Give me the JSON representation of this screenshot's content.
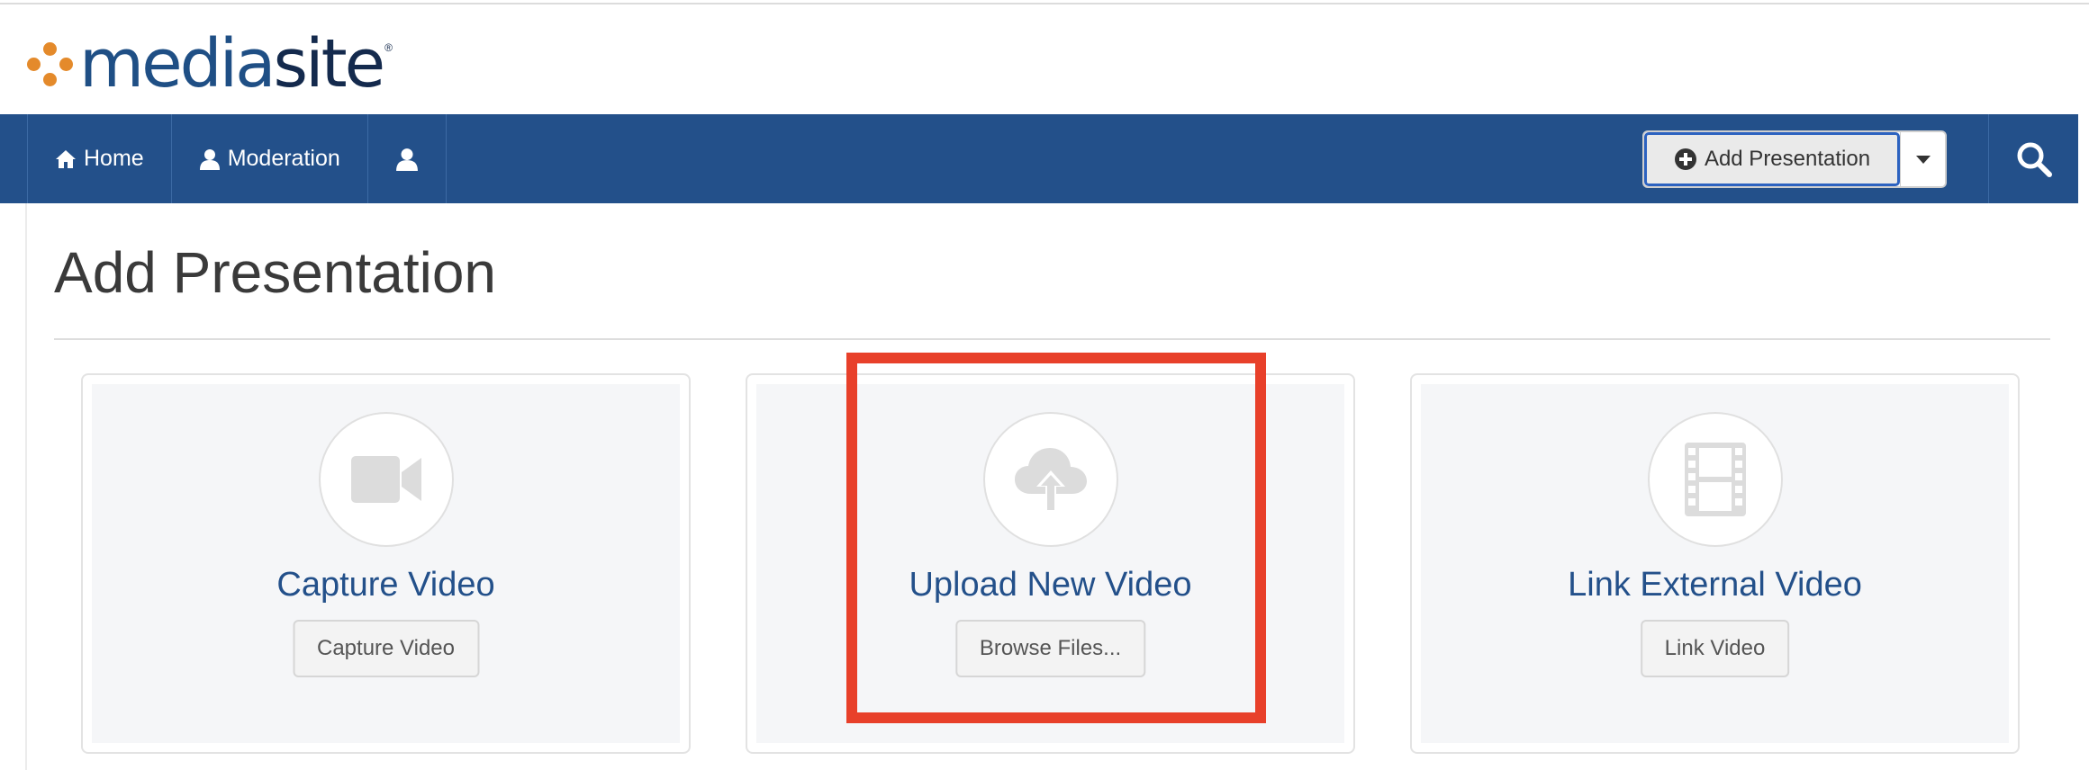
{
  "logo": {
    "brand_part1": "media",
    "brand_part2": "site",
    "registered": "®"
  },
  "nav": {
    "items": [
      {
        "label": "Home",
        "icon": "home-icon"
      },
      {
        "label": "Moderation",
        "icon": "user-icon"
      },
      {
        "label": "",
        "icon": "user-icon"
      }
    ],
    "add_presentation_label": "Add Presentation",
    "add_presentation_icon": "plus-circle-icon",
    "dropdown_icon": "caret-down-icon",
    "search_icon": "search-icon",
    "bar_color": "#23508a"
  },
  "page": {
    "title": "Add Presentation"
  },
  "cards": [
    {
      "title": "Capture Video",
      "button_label": "Capture Video",
      "icon": "video-camera-icon"
    },
    {
      "title": "Upload New Video",
      "button_label": "Browse Files...",
      "icon": "cloud-upload-icon"
    },
    {
      "title": "Link External Video",
      "button_label": "Link Video",
      "icon": "film-icon"
    }
  ],
  "highlight": {
    "color": "#e8402a",
    "target": "Upload New Video"
  }
}
